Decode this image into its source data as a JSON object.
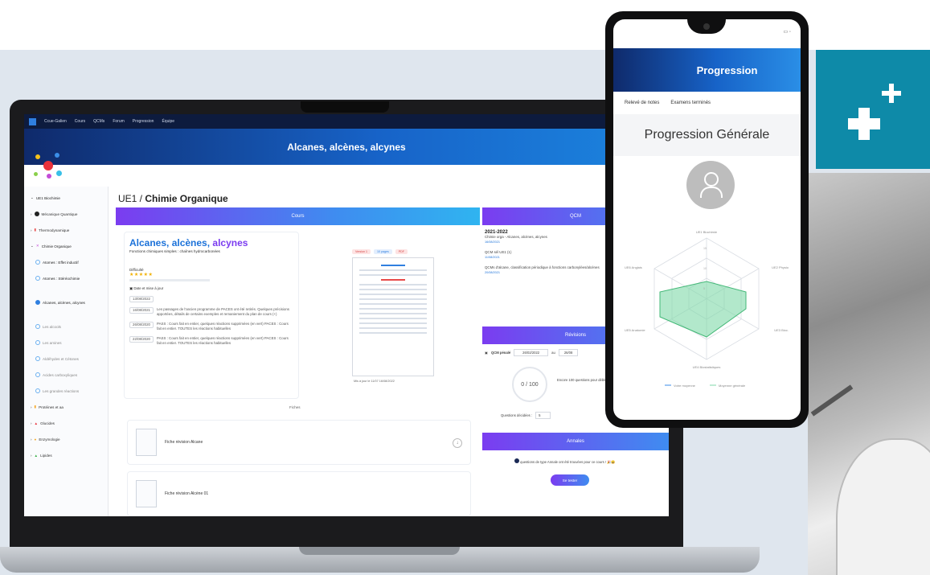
{
  "laptop": {
    "topbar": {
      "brand": "Ccue-Galien",
      "nav": [
        "Cours",
        "QCMs",
        "Forum",
        "Progression",
        "Équipe"
      ]
    },
    "banner_title": "Alcanes, alcènes, alcynes",
    "breadcrumb_ue": "UE1",
    "breadcrumb_sep": " / ",
    "page_title": "Chimie Organique",
    "sidebar": {
      "items": [
        {
          "label": "UE1 Biochimie"
        },
        {
          "label": "Mécanique Quantique"
        },
        {
          "label": "Thermodynamique"
        },
        {
          "label": "Chimie Organique"
        },
        {
          "label": "Atomes : Effet inductif"
        },
        {
          "label": "Atomes : Stéréochimie"
        },
        {
          "label": "Alcanes, alcènes, alcynes"
        },
        {
          "label": "Les alcools"
        },
        {
          "label": "Les amines"
        },
        {
          "label": "Aldéhydes et Cétones"
        },
        {
          "label": "Acides carboxyliques"
        },
        {
          "label": "Les grandes réactions"
        },
        {
          "label": "Protéines et aa"
        },
        {
          "label": "Glucides"
        },
        {
          "label": "Enzymologie"
        },
        {
          "label": "Lipides"
        }
      ]
    },
    "cours": {
      "header": "Cours",
      "title_part1": "Alcanes, alcènes, ",
      "title_part2": "alcynes",
      "subtitle": "Fonctions chimiques simples : chaînes hydrocarbonées",
      "difficulty_label": "Difficulté",
      "stars": "★★★★★",
      "date_label": "Date et mise à jour",
      "timeline": [
        {
          "date": "13/08/2022",
          "text": ""
        },
        {
          "date": "16/08/2021",
          "text": "Les passages de l'ancien programme de PACES ont été retirés. Quelques précisions apportées, détails de certains exemples et remaniement du plan de cours (+)"
        },
        {
          "date": "26/08/2020",
          "text": "PASS : Cours fait en entier, quelques réactions supprimées (en vert) PACES : Cours fait en entier. TOUTES les réactions habituelles"
        },
        {
          "date": "22/08/2020",
          "text": "PASS : Cours fait en entier, quelques réactions supprimées (en vert) PACES : Cours fait en entier. TOUTES les réactions habituelles"
        }
      ],
      "tags": [
        "Version 1",
        "10 pages",
        "PDF"
      ],
      "doc_update": "Mis à jour le 11/07 16/08/2022",
      "fiches_label": "Fiches",
      "fiches": [
        {
          "title": "Fiche révision Alcane"
        },
        {
          "title": "Fiche révision Alcène 01"
        }
      ],
      "download_icon": "↓"
    },
    "qcm": {
      "header": "QCM",
      "entries": [
        {
          "title": "2021-2022",
          "desc": "Chimie orga - Alcanes, alcènes, alcynes",
          "meta": "16/08/2021"
        },
        {
          "title": "",
          "desc": "QCM sél UE1 (1)",
          "meta": "11/08/2021"
        },
        {
          "title": "",
          "desc": "QCMs d'alcane, classification périodique à fonctions carbonylées/alcènes",
          "meta": "20/08/2021"
        }
      ]
    },
    "revisions": {
      "header": "Révisions",
      "period_label": "QCM pénalé",
      "from": "26/02/2022",
      "to_label": "au",
      "to": "26/08",
      "score": "0 / 100",
      "score_text": "Encore 100 questions pour débloquer",
      "questions_label": "Questions décidées :",
      "questions_value": "5"
    },
    "annales": {
      "header": "Annales",
      "text": "questions de type Annale ont été trouvées pour ce cours ! 🎉😄",
      "button": "Se tester"
    }
  },
  "phone": {
    "header_title": "Progression",
    "tabs": [
      "Relevé de notes",
      "Examens terminés"
    ],
    "section_title": "Progression Générale",
    "radar": {
      "axes": [
        "UE1 Biochimie",
        "UE2 Physio",
        "UE3 Bioc.",
        "UE4 Biostatistiques",
        "UE5 Anatomie",
        "UE6 Anglais"
      ],
      "ticks": [
        "15",
        "10",
        "5"
      ],
      "legend": [
        "Votre moyenne",
        "Moyenne générale"
      ]
    }
  }
}
